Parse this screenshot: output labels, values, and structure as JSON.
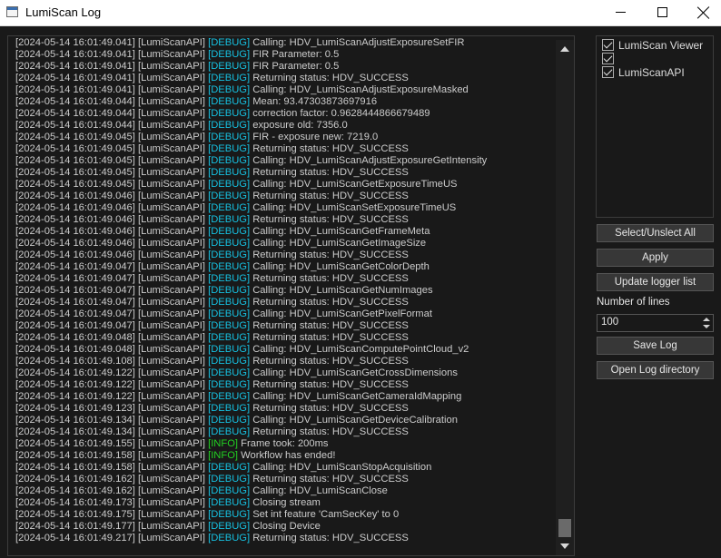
{
  "window": {
    "title": "LumiScan Log"
  },
  "log_lines": [
    {
      "ts": "[2024-05-14 16:01:49.041]",
      "src": "[LumiScanAPI]",
      "lvl": "DEBUG",
      "msg": "Calling: HDV_LumiScanAdjustExposureSetFIR"
    },
    {
      "ts": "[2024-05-14 16:01:49.041]",
      "src": "[LumiScanAPI]",
      "lvl": "DEBUG",
      "msg": "FIR Parameter: 0.5"
    },
    {
      "ts": "[2024-05-14 16:01:49.041]",
      "src": "[LumiScanAPI]",
      "lvl": "DEBUG",
      "msg": "FIR Parameter: 0.5"
    },
    {
      "ts": "[2024-05-14 16:01:49.041]",
      "src": "[LumiScanAPI]",
      "lvl": "DEBUG",
      "msg": "Returning status: HDV_SUCCESS"
    },
    {
      "ts": "[2024-05-14 16:01:49.041]",
      "src": "[LumiScanAPI]",
      "lvl": "DEBUG",
      "msg": "Calling: HDV_LumiScanAdjustExposureMasked"
    },
    {
      "ts": "[2024-05-14 16:01:49.044]",
      "src": "[LumiScanAPI]",
      "lvl": "DEBUG",
      "msg": "Mean: 93.47303873697916"
    },
    {
      "ts": "[2024-05-14 16:01:49.044]",
      "src": "[LumiScanAPI]",
      "lvl": "DEBUG",
      "msg": "correction factor: 0.9628444866679489"
    },
    {
      "ts": "[2024-05-14 16:01:49.044]",
      "src": "[LumiScanAPI]",
      "lvl": "DEBUG",
      "msg": "exposure old: 7356.0"
    },
    {
      "ts": "[2024-05-14 16:01:49.045]",
      "src": "[LumiScanAPI]",
      "lvl": "DEBUG",
      "msg": "FIR - exposure new: 7219.0"
    },
    {
      "ts": "[2024-05-14 16:01:49.045]",
      "src": "[LumiScanAPI]",
      "lvl": "DEBUG",
      "msg": "Returning status: HDV_SUCCESS"
    },
    {
      "ts": "[2024-05-14 16:01:49.045]",
      "src": "[LumiScanAPI]",
      "lvl": "DEBUG",
      "msg": "Calling: HDV_LumiScanAdjustExposureGetIntensity"
    },
    {
      "ts": "[2024-05-14 16:01:49.045]",
      "src": "[LumiScanAPI]",
      "lvl": "DEBUG",
      "msg": "Returning status: HDV_SUCCESS"
    },
    {
      "ts": "[2024-05-14 16:01:49.045]",
      "src": "[LumiScanAPI]",
      "lvl": "DEBUG",
      "msg": "Calling: HDV_LumiScanGetExposureTimeUS"
    },
    {
      "ts": "[2024-05-14 16:01:49.046]",
      "src": "[LumiScanAPI]",
      "lvl": "DEBUG",
      "msg": "Returning status: HDV_SUCCESS"
    },
    {
      "ts": "[2024-05-14 16:01:49.046]",
      "src": "[LumiScanAPI]",
      "lvl": "DEBUG",
      "msg": "Calling: HDV_LumiScanSetExposureTimeUS"
    },
    {
      "ts": "[2024-05-14 16:01:49.046]",
      "src": "[LumiScanAPI]",
      "lvl": "DEBUG",
      "msg": "Returning status: HDV_SUCCESS"
    },
    {
      "ts": "[2024-05-14 16:01:49.046]",
      "src": "[LumiScanAPI]",
      "lvl": "DEBUG",
      "msg": "Calling: HDV_LumiScanGetFrameMeta"
    },
    {
      "ts": "[2024-05-14 16:01:49.046]",
      "src": "[LumiScanAPI]",
      "lvl": "DEBUG",
      "msg": "Calling: HDV_LumiScanGetImageSize"
    },
    {
      "ts": "[2024-05-14 16:01:49.046]",
      "src": "[LumiScanAPI]",
      "lvl": "DEBUG",
      "msg": "Returning status: HDV_SUCCESS"
    },
    {
      "ts": "[2024-05-14 16:01:49.047]",
      "src": "[LumiScanAPI]",
      "lvl": "DEBUG",
      "msg": "Calling: HDV_LumiScanGetColorDepth"
    },
    {
      "ts": "[2024-05-14 16:01:49.047]",
      "src": "[LumiScanAPI]",
      "lvl": "DEBUG",
      "msg": "Returning status: HDV_SUCCESS"
    },
    {
      "ts": "[2024-05-14 16:01:49.047]",
      "src": "[LumiScanAPI]",
      "lvl": "DEBUG",
      "msg": "Calling: HDV_LumiScanGetNumImages"
    },
    {
      "ts": "[2024-05-14 16:01:49.047]",
      "src": "[LumiScanAPI]",
      "lvl": "DEBUG",
      "msg": "Returning status: HDV_SUCCESS"
    },
    {
      "ts": "[2024-05-14 16:01:49.047]",
      "src": "[LumiScanAPI]",
      "lvl": "DEBUG",
      "msg": "Calling: HDV_LumiScanGetPixelFormat"
    },
    {
      "ts": "[2024-05-14 16:01:49.047]",
      "src": "[LumiScanAPI]",
      "lvl": "DEBUG",
      "msg": "Returning status: HDV_SUCCESS"
    },
    {
      "ts": "[2024-05-14 16:01:49.048]",
      "src": "[LumiScanAPI]",
      "lvl": "DEBUG",
      "msg": "Returning status: HDV_SUCCESS"
    },
    {
      "ts": "[2024-05-14 16:01:49.048]",
      "src": "[LumiScanAPI]",
      "lvl": "DEBUG",
      "msg": "Calling: HDV_LumiScanComputePointCloud_v2"
    },
    {
      "ts": "[2024-05-14 16:01:49.108]",
      "src": "[LumiScanAPI]",
      "lvl": "DEBUG",
      "msg": "Returning status: HDV_SUCCESS"
    },
    {
      "ts": "[2024-05-14 16:01:49.122]",
      "src": "[LumiScanAPI]",
      "lvl": "DEBUG",
      "msg": "Calling: HDV_LumiScanGetCrossDimensions"
    },
    {
      "ts": "[2024-05-14 16:01:49.122]",
      "src": "[LumiScanAPI]",
      "lvl": "DEBUG",
      "msg": "Returning status: HDV_SUCCESS"
    },
    {
      "ts": "[2024-05-14 16:01:49.122]",
      "src": "[LumiScanAPI]",
      "lvl": "DEBUG",
      "msg": "Calling: HDV_LumiScanGetCameraIdMapping"
    },
    {
      "ts": "[2024-05-14 16:01:49.123]",
      "src": "[LumiScanAPI]",
      "lvl": "DEBUG",
      "msg": "Returning status: HDV_SUCCESS"
    },
    {
      "ts": "[2024-05-14 16:01:49.134]",
      "src": "[LumiScanAPI]",
      "lvl": "DEBUG",
      "msg": "Calling: HDV_LumiScanGetDeviceCalibration"
    },
    {
      "ts": "[2024-05-14 16:01:49.134]",
      "src": "[LumiScanAPI]",
      "lvl": "DEBUG",
      "msg": "Returning status: HDV_SUCCESS"
    },
    {
      "ts": "[2024-05-14 16:01:49.155]",
      "src": "[LumiScanAPI]",
      "lvl": "INFO",
      "msg": "Frame took: 200ms"
    },
    {
      "ts": "[2024-05-14 16:01:49.158]",
      "src": "[LumiScanAPI]",
      "lvl": "INFO",
      "msg": "Workflow has ended!"
    },
    {
      "ts": "[2024-05-14 16:01:49.158]",
      "src": "[LumiScanAPI]",
      "lvl": "DEBUG",
      "msg": "Calling: HDV_LumiScanStopAcquisition"
    },
    {
      "ts": "[2024-05-14 16:01:49.162]",
      "src": "[LumiScanAPI]",
      "lvl": "DEBUG",
      "msg": "Returning status: HDV_SUCCESS"
    },
    {
      "ts": "[2024-05-14 16:01:49.162]",
      "src": "[LumiScanAPI]",
      "lvl": "DEBUG",
      "msg": "Calling: HDV_LumiScanClose"
    },
    {
      "ts": "[2024-05-14 16:01:49.173]",
      "src": "[LumiScanAPI]",
      "lvl": "DEBUG",
      "msg": "Closing stream"
    },
    {
      "ts": "[2024-05-14 16:01:49.175]",
      "src": "[LumiScanAPI]",
      "lvl": "DEBUG",
      "msg": "Set int feature 'CamSecKey' to 0"
    },
    {
      "ts": "[2024-05-14 16:01:49.177]",
      "src": "[LumiScanAPI]",
      "lvl": "DEBUG",
      "msg": "Closing Device"
    },
    {
      "ts": "[2024-05-14 16:01:49.217]",
      "src": "[LumiScanAPI]",
      "lvl": "DEBUG",
      "msg": "Returning status: HDV_SUCCESS"
    }
  ],
  "loggers": [
    {
      "label": "LumiScan Viewer",
      "checked": true
    },
    {
      "label": "",
      "checked": true
    },
    {
      "label": "LumiScanAPI",
      "checked": true
    }
  ],
  "buttons": {
    "select_all": "Select/Unslect All",
    "apply": "Apply",
    "update_list": "Update logger list",
    "save_log": "Save Log",
    "open_dir": "Open Log directory"
  },
  "lines": {
    "label": "Number of lines",
    "value": "100"
  },
  "colors": {
    "debug": "#16c0e0",
    "info": "#22d022",
    "text": "#cccccc",
    "background": "#191919"
  }
}
